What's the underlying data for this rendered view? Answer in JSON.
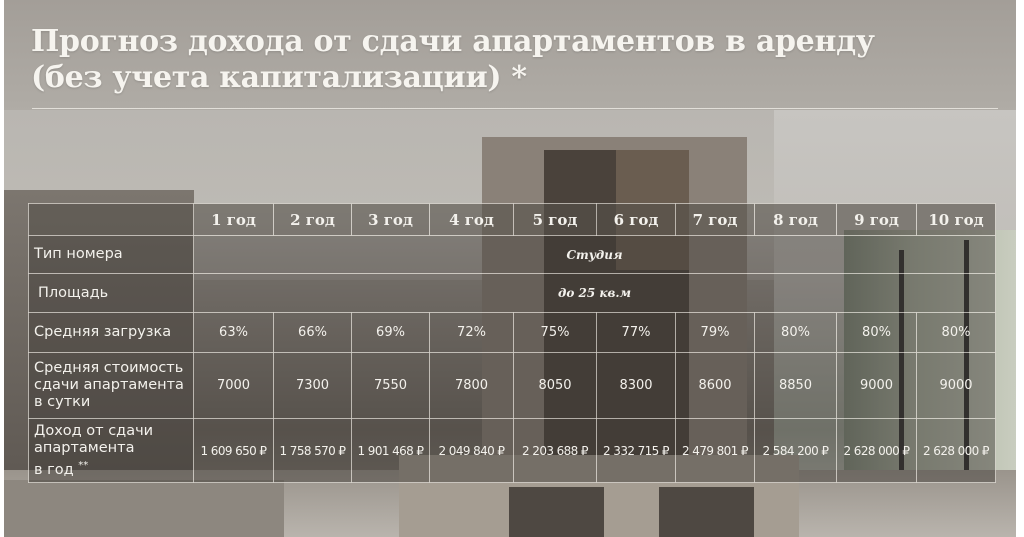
{
  "title": {
    "line1": "Прогноз дохода от сдачи апартаментов в аренду",
    "line2": "(без учета капитализации) *"
  },
  "table": {
    "corner": "",
    "years": [
      "1 год",
      "2 год",
      "3 год",
      "4 год",
      "5 год",
      "6 год",
      "7 год",
      "8 год",
      "9 год",
      "10 год"
    ],
    "rows": {
      "room_type": {
        "label": "Тип номера",
        "value": "Студия"
      },
      "area": {
        "label": "Площадь",
        "value": "до 25 кв.м"
      },
      "avg_occupancy": {
        "label": "Средняя загрузка",
        "values": [
          "63%",
          "66%",
          "69%",
          "72%",
          "75%",
          "77%",
          "79%",
          "80%",
          "80%",
          "80%"
        ]
      },
      "avg_daily_rate": {
        "label_line1": "Средняя стоимость",
        "label_line2": "сдачи апартамента",
        "label_line3": "в сутки",
        "values": [
          "7000",
          "7300",
          "7550",
          "7800",
          "8050",
          "8300",
          "8600",
          "8850",
          "9000",
          "9000"
        ]
      },
      "annual_income": {
        "label_line1": "Доход от сдачи",
        "label_line2": "апартамента",
        "label_line3": "в год",
        "label_note": "**",
        "values": [
          "1 609 650 ₽",
          "1 758 570 ₽",
          "1 901 468 ₽",
          "2 049 840 ₽",
          "2 203 688 ₽",
          "2 332 715 ₽",
          "2 479 801 ₽",
          "2 584 200 ₽",
          "2 628 000 ₽",
          "2 628 000 ₽"
        ]
      }
    }
  }
}
